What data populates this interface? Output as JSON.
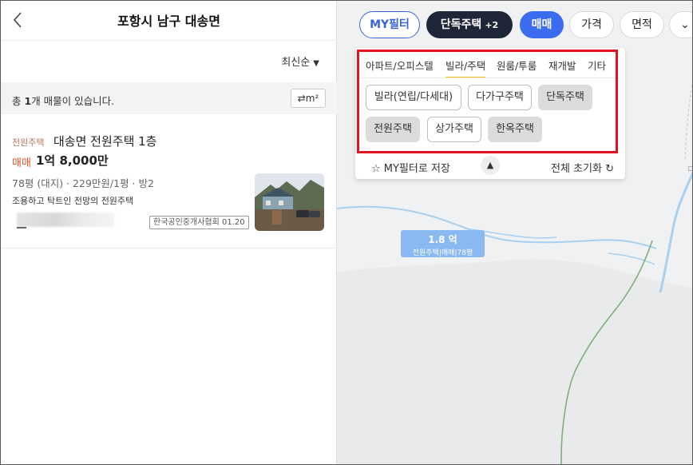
{
  "left_panel": {
    "title": "포항시 남구 대송면",
    "sort_label": "최신순",
    "count_prefix": "총 ",
    "count_number": "1",
    "count_suffix": "개 매물이 있습니다.",
    "unit_toggle": "m²",
    "listing": {
      "property_type": "전원주택",
      "name": "대송면 전원주택 1층",
      "deal_type": "매매",
      "price": "1억 8,000만",
      "spec": "78평 (대지) · 229만원/1평 · 방2",
      "description": "조용하고 탁트인 전망의 전원주택",
      "agency": "한국공인중개사협회 01.20"
    }
  },
  "map": {
    "chips": {
      "my_filter": "MY필터",
      "type_filter": "단독주택",
      "type_more": "+2",
      "deal": "매매",
      "price": "가격",
      "area": "면적"
    },
    "filter_panel": {
      "tabs": [
        "아파트/오피스텔",
        "빌라/주택",
        "원룸/투룸",
        "재개발",
        "기타"
      ],
      "options": [
        {
          "label": "빌라(연립/다세대)",
          "selected": false
        },
        {
          "label": "다가구주택",
          "selected": false
        },
        {
          "label": "단독주택",
          "selected": true
        },
        {
          "label": "전원주택",
          "selected": true
        },
        {
          "label": "상가주택",
          "selected": false
        },
        {
          "label": "한옥주택",
          "selected": true
        }
      ],
      "save_label": "MY필터로 저장",
      "reset_label": "전체 초기화"
    },
    "marker": {
      "price": "1.8 억",
      "sub": "전원주택|매매|78평"
    }
  },
  "colors": {
    "deal_accent": "#e8542a",
    "type_accent": "#b07a5a",
    "chip_blue": "#3b6cf0",
    "chip_dark": "#1e2637",
    "highlight_box": "#e0141f",
    "active_tab_underline": "#f0c420",
    "marker": "#8ab9f2"
  }
}
